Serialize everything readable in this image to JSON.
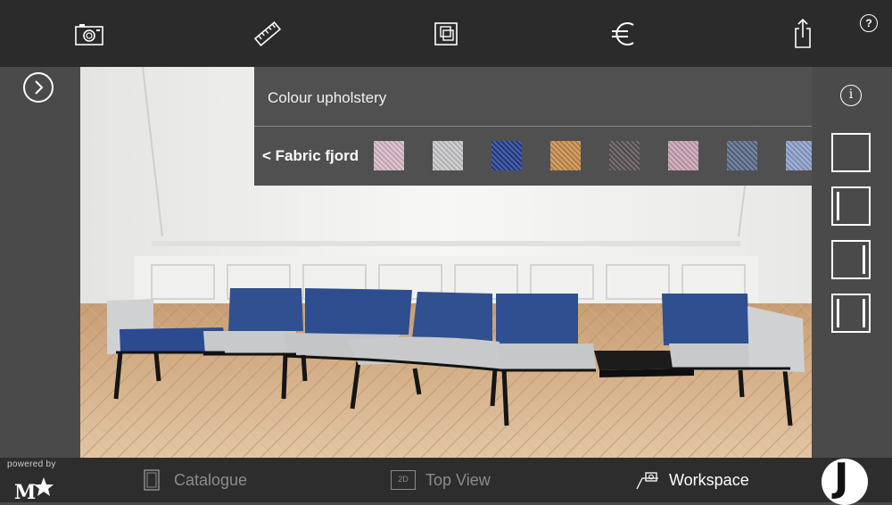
{
  "toolbar": {
    "icons": [
      "camera-icon",
      "ruler-icon",
      "copy-icon",
      "euro-icon",
      "share-icon"
    ],
    "help_label": "?"
  },
  "panel": {
    "title": "Colour upholstery",
    "back_label": "< Fabric fjord",
    "info_label": "i",
    "swatches": [
      {
        "name": "pink",
        "color": "#d7b9c8"
      },
      {
        "name": "light-grey",
        "color": "#c8c8cc"
      },
      {
        "name": "royal-blue",
        "color": "#24408f"
      },
      {
        "name": "ochre",
        "color": "#c98d4c"
      },
      {
        "name": "charcoal",
        "color": "#5a5256"
      },
      {
        "name": "rose",
        "color": "#c9a3b5"
      },
      {
        "name": "slate-blue",
        "color": "#5c6b8a"
      },
      {
        "name": "periwinkle",
        "color": "#8da0cc"
      }
    ]
  },
  "layouts": [
    "single",
    "left-arm",
    "right-arm",
    "both-arms"
  ],
  "bottom": {
    "powered_by": "powered by",
    "nav": [
      {
        "label": "Catalogue",
        "active": false
      },
      {
        "label": "Top View",
        "icon_text": "2D",
        "active": false
      },
      {
        "label": "Workspace",
        "active": true
      }
    ],
    "brand_letter": "J"
  },
  "colors": {
    "toolbar_bg": "#2b2b2b",
    "panel_bg": "#4a4a4a",
    "sofa_blue": "#2f4a8e",
    "sofa_grey": "#c6c7c9"
  }
}
